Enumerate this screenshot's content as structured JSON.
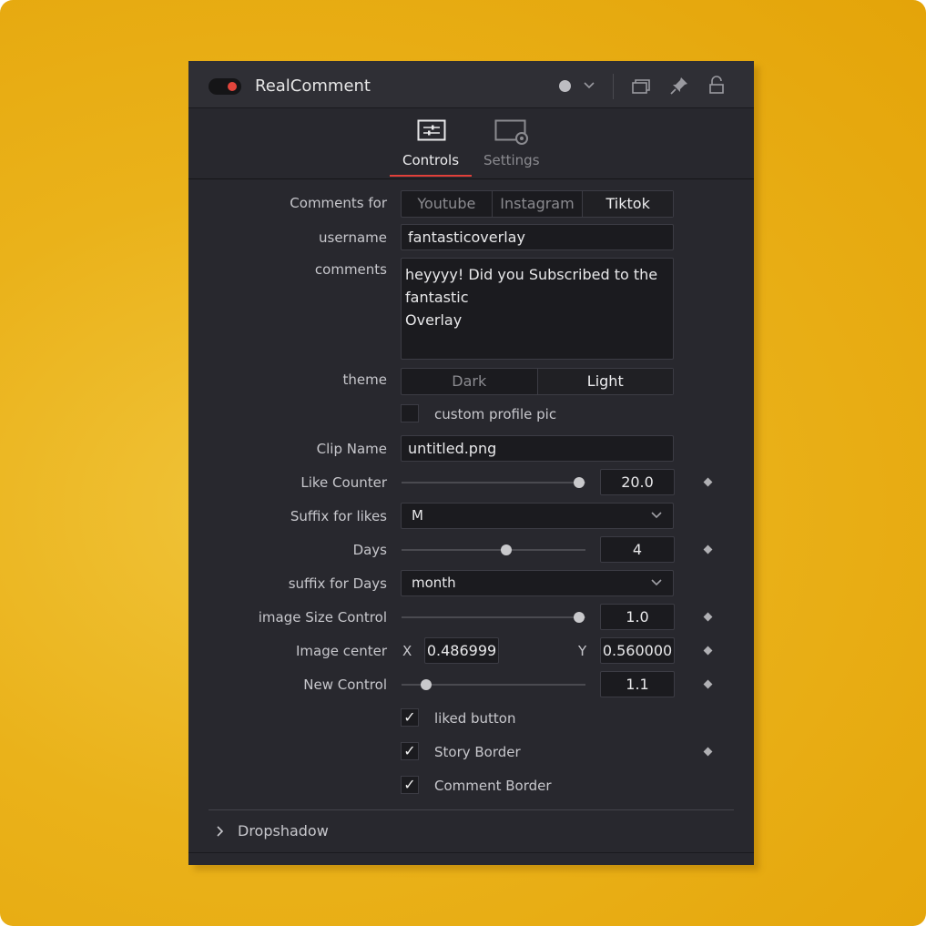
{
  "header": {
    "title": "RealComment"
  },
  "tabs": [
    {
      "label": "Controls",
      "active": true,
      "icon": "sliders-icon"
    },
    {
      "label": "Settings",
      "active": false,
      "icon": "settings-icon"
    }
  ],
  "controls": {
    "comments_for": {
      "label": "Comments for",
      "options": [
        "Youtube",
        "Instagram",
        "Tiktok"
      ],
      "selected": "Tiktok"
    },
    "username": {
      "label": "username",
      "value": "fantasticoverlay"
    },
    "comments": {
      "label": "comments",
      "lines": [
        "heyyyy! Did you Subscribed to the",
        "fantastic",
        "Overlay"
      ]
    },
    "theme": {
      "label": "theme",
      "options": [
        "Dark",
        "Light"
      ],
      "selected": "Light"
    },
    "custom_profile_pic": {
      "label": "custom profile pic",
      "checked": false
    },
    "clip_name": {
      "label": "Clip Name",
      "value": "untitled.png"
    },
    "like_counter": {
      "label": "Like Counter",
      "value": "20.0"
    },
    "suffix_likes": {
      "label": "Suffix for likes",
      "value": "M"
    },
    "days": {
      "label": "Days",
      "value": "4"
    },
    "suffix_days": {
      "label": "suffix for Days",
      "value": "month"
    },
    "image_size": {
      "label": "image Size Control",
      "value": "1.0"
    },
    "image_center": {
      "label": "Image center",
      "x_label": "X",
      "x_value": "0.486999",
      "y_label": "Y",
      "y_value": "0.560000"
    },
    "new_control": {
      "label": "New Control",
      "value": "1.1"
    },
    "liked_button": {
      "label": "liked button",
      "checked": true
    },
    "story_border": {
      "label": "Story Border",
      "checked": true
    },
    "comment_border": {
      "label": "Comment Border",
      "checked": true
    },
    "dropshadow": {
      "label": "Dropshadow"
    }
  },
  "colors": {
    "background": "#e9ad14",
    "panel": "#28282e",
    "accent_red": "#e0403a"
  }
}
